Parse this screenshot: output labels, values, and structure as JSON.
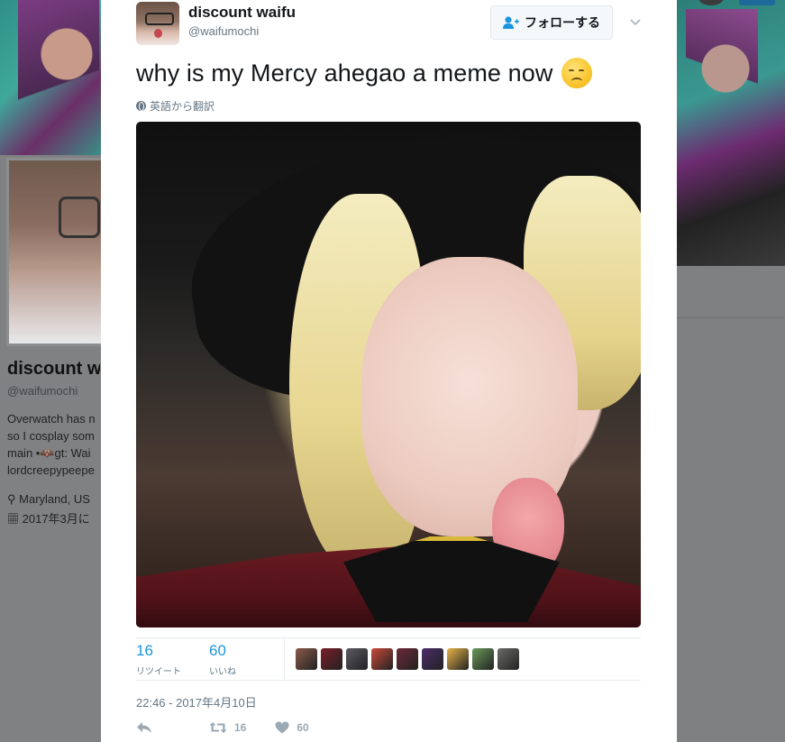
{
  "background": {
    "profile_name": "discount w",
    "profile_handle": "@waifumochi",
    "bio_lines": [
      "Overwatch has n",
      "so I cosplay som",
      "main •🦇gt: Wai",
      "lordcreepypeepe"
    ],
    "location": "Maryland, US",
    "joined": "2017年3月に"
  },
  "tweet": {
    "display_name": "discount waifu",
    "screen_name": "@waifumochi",
    "follow_label": "フォローする",
    "text": "why is my Mercy ahegao a meme now",
    "emoji": "disappointed-face",
    "translate_label": "英語から翻訳",
    "stats": {
      "retweets": "16",
      "retweets_label": "リツイート",
      "likes": "60",
      "likes_label": "いいね"
    },
    "liker_avatar_colors": [
      "#8a5a4a",
      "#7a1f28",
      "#5a5a62",
      "#c94a3a",
      "#6b2a3a",
      "#4a2d6b",
      "#e7b54a",
      "#6a9a5a",
      "#6a6a66"
    ],
    "timestamp": "22:46 - 2017年4月10日",
    "action_counts": {
      "retweet": "16",
      "like": "60"
    }
  },
  "colors": {
    "link_blue": "#1b95e0",
    "muted_text": "#657786",
    "action_icon": "#9aa9b4"
  }
}
